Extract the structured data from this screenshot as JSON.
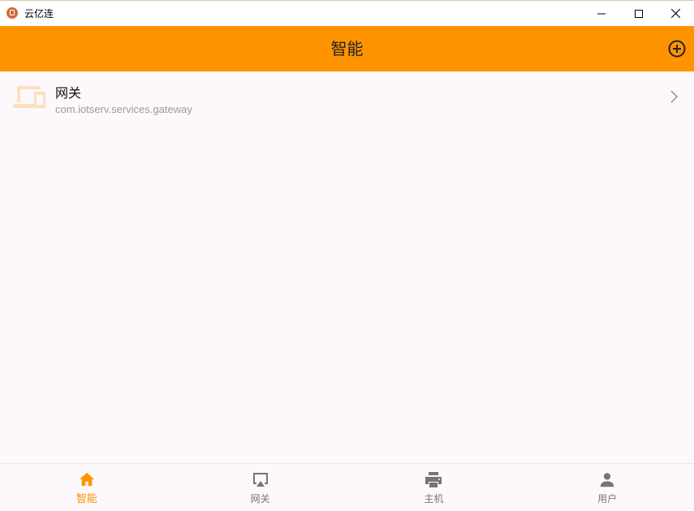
{
  "window": {
    "title": "云亿连",
    "controls": {
      "minimize": "minimize-icon",
      "maximize": "maximize-icon",
      "close": "close-icon"
    }
  },
  "header": {
    "title": "智能",
    "action_icon": "add-circle-icon",
    "color": "#ff9400"
  },
  "list": {
    "items": [
      {
        "title": "网关",
        "subtitle": "com.iotserv.services.gateway",
        "icon": "devices-icon",
        "icon_color": "#fbe2bd"
      }
    ]
  },
  "bottom_nav": {
    "active_color": "#ff9400",
    "inactive_color": "#757575",
    "tabs": [
      {
        "label": "智能",
        "icon": "home-icon",
        "active": true
      },
      {
        "label": "网关",
        "icon": "airplay-icon",
        "active": false
      },
      {
        "label": "主机",
        "icon": "printer-icon",
        "active": false
      },
      {
        "label": "用户",
        "icon": "person-icon",
        "active": false
      }
    ]
  }
}
